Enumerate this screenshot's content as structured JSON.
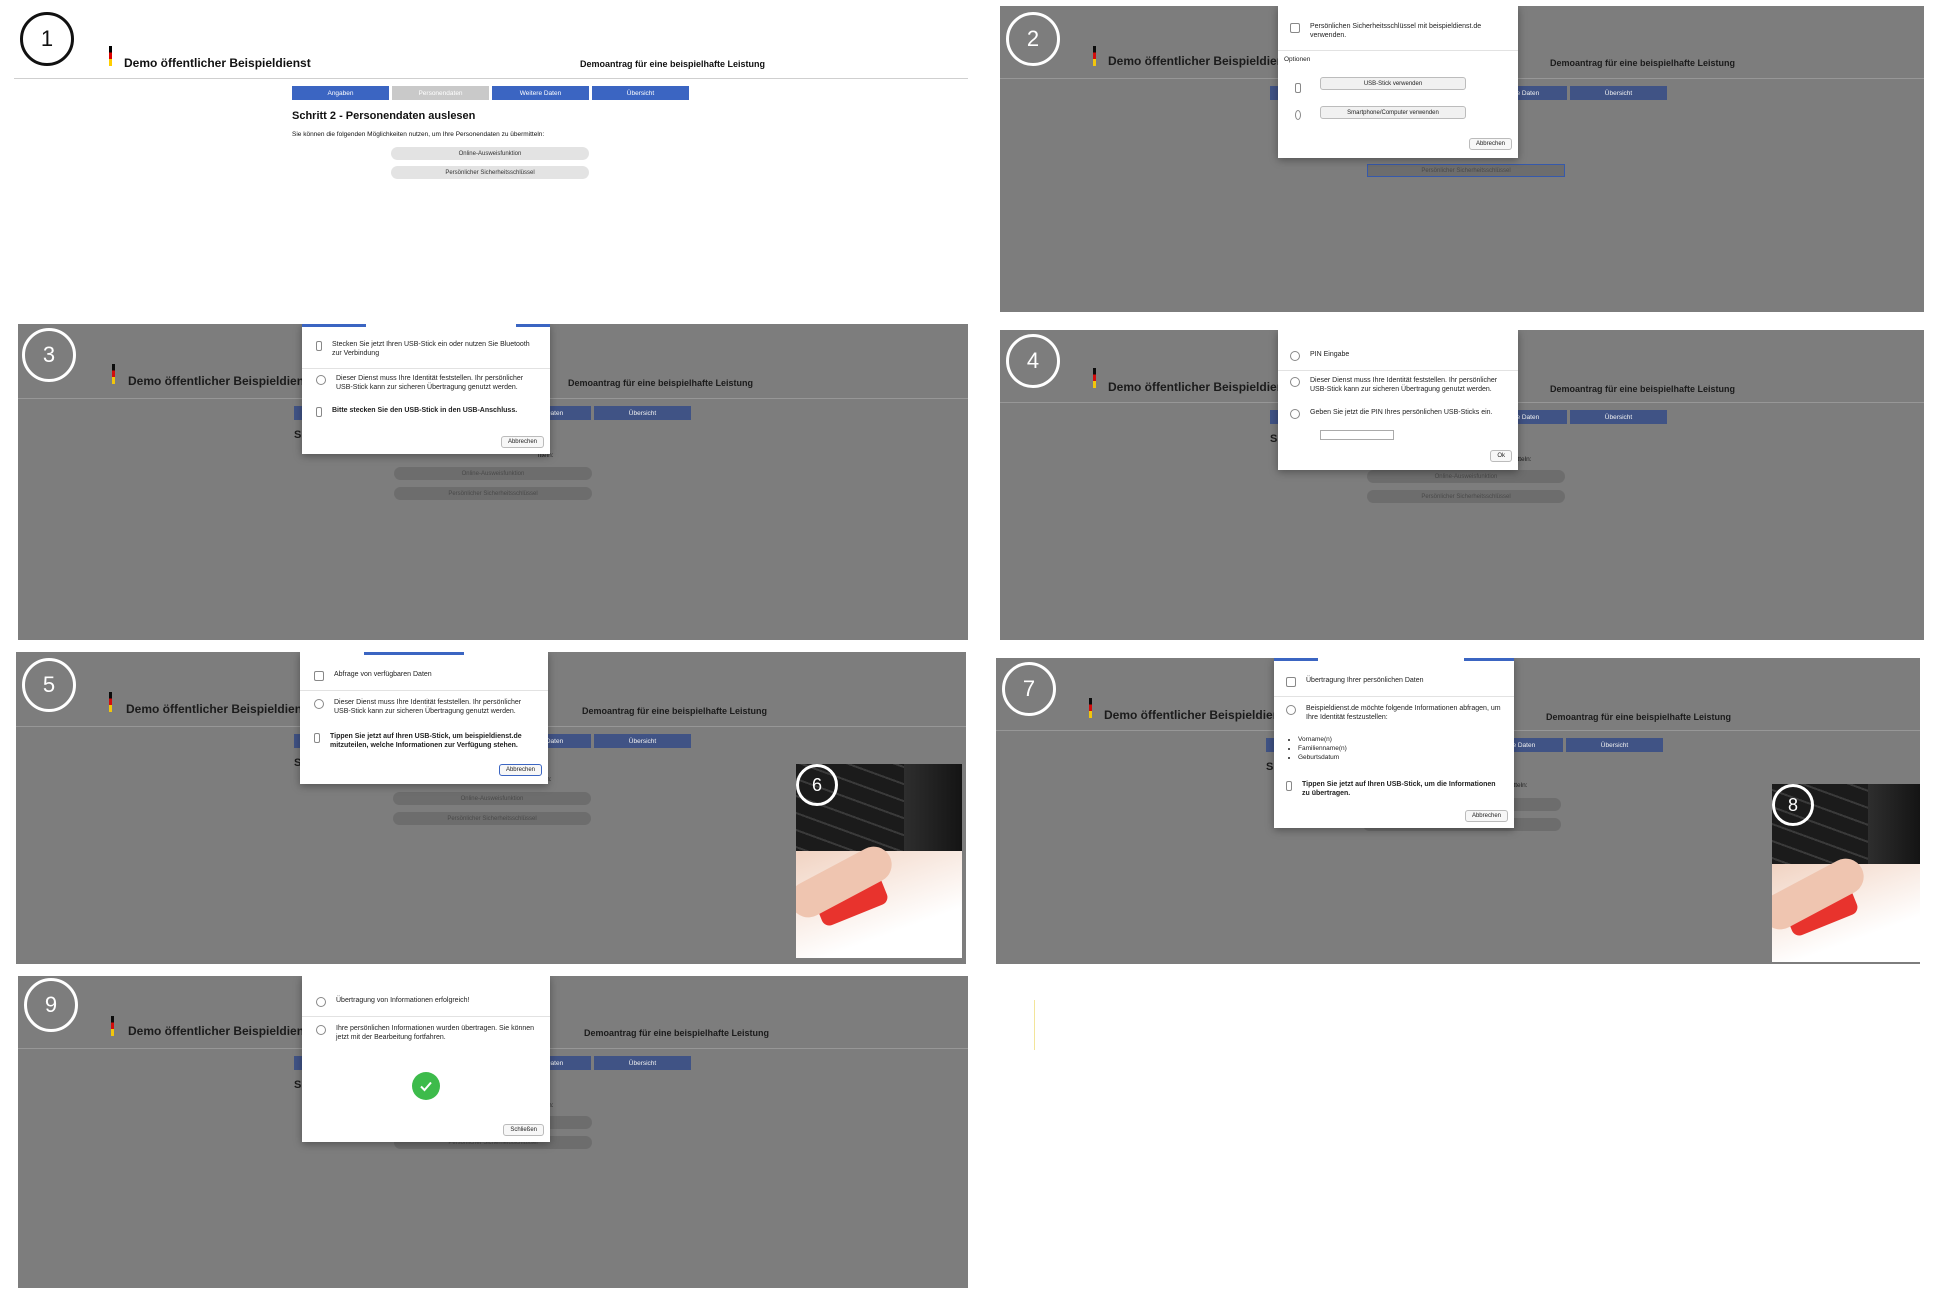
{
  "brand": "Demo öffentlicher Beispieldienst",
  "demo_title": "Demoantrag für eine beispielhafte Leistung",
  "tabs": [
    "Angaben",
    "Personendaten",
    "Weitere Daten",
    "Übersicht"
  ],
  "tabs_short": {
    "weitere": "aten",
    "uebersicht": "Übersicht"
  },
  "step_title": "Schritt 2 - Personendaten auslesen",
  "step_title_short": "S",
  "step_intro": "Sie können die folgenden Möglichkeiten nutzen, um Ihre Personendaten zu übermitteln:",
  "intro_tail": "itteln:",
  "options": [
    "Online-Ausweisfunktion",
    "Persönlicher Sicherheitsschlüssel"
  ],
  "badges": [
    "1",
    "2",
    "3",
    "4",
    "5",
    "6",
    "7",
    "8",
    "9"
  ],
  "dialog2": {
    "head": "Persönlichen Sicherheitsschlüssel mit beispieldienst.de verwenden.",
    "options_label": "Optionen",
    "usb": "USB-Stick verwenden",
    "phone": "Smartphone/Computer verwenden",
    "cancel": "Abbrechen"
  },
  "dialog3": {
    "head": "Stecken Sie jetzt Ihren USB-Stick ein oder nutzen Sie Bluetooth zur Verbindung",
    "info": "Dieser Dienst muss Ihre Identität feststellen. Ihr persönlicher USB-Stick kann zur sicheren Übertragung genutzt werden.",
    "instr": "Bitte stecken Sie den USB-Stick in den USB-Anschluss.",
    "cancel": "Abbrechen"
  },
  "dialog4": {
    "head": "PIN Eingabe",
    "info": "Dieser Dienst muss Ihre Identität feststellen. Ihr persönlicher USB-Stick kann zur sicheren Übertragung genutzt werden.",
    "instr": "Geben Sie jetzt die PIN Ihres persönlichen USB-Sticks ein.",
    "pin_value": "",
    "ok": "Ok"
  },
  "dialog5": {
    "head": "Abfrage von verfügbaren Daten",
    "info": "Dieser Dienst muss Ihre Identität feststellen. Ihr persönlicher USB-Stick kann zur sicheren Übertragung genutzt werden.",
    "instr": "Tippen Sie jetzt auf Ihren USB-Stick, um beispieldienst.de mitzuteilen, welche Informationen zur Verfügung stehen.",
    "cancel": "Abbrechen"
  },
  "dialog7": {
    "head": "Übertragung Ihrer persönlichen Daten",
    "info": "Beispieldienst.de möchte folgende Informationen abfragen, um Ihre Identität festzustellen:",
    "items": [
      "Vorname(n)",
      "Familienname(n)",
      "Geburtsdatum"
    ],
    "instr": "Tippen Sie jetzt auf Ihren USB-Stick, um die Informationen zu übertragen.",
    "cancel": "Abbrechen"
  },
  "dialog9": {
    "head": "Übertragung von Informationen erfolgreich!",
    "info": "Ihre persönlichen Informationen wurden übertragen. Sie können jetzt mit der Bearbeitung fortfahren.",
    "close": "Schließen"
  },
  "colors": {
    "accent": "#3b65c2",
    "overlay": "#7d7d7d",
    "success": "#3dbb4b",
    "usb": "#e8332d"
  }
}
